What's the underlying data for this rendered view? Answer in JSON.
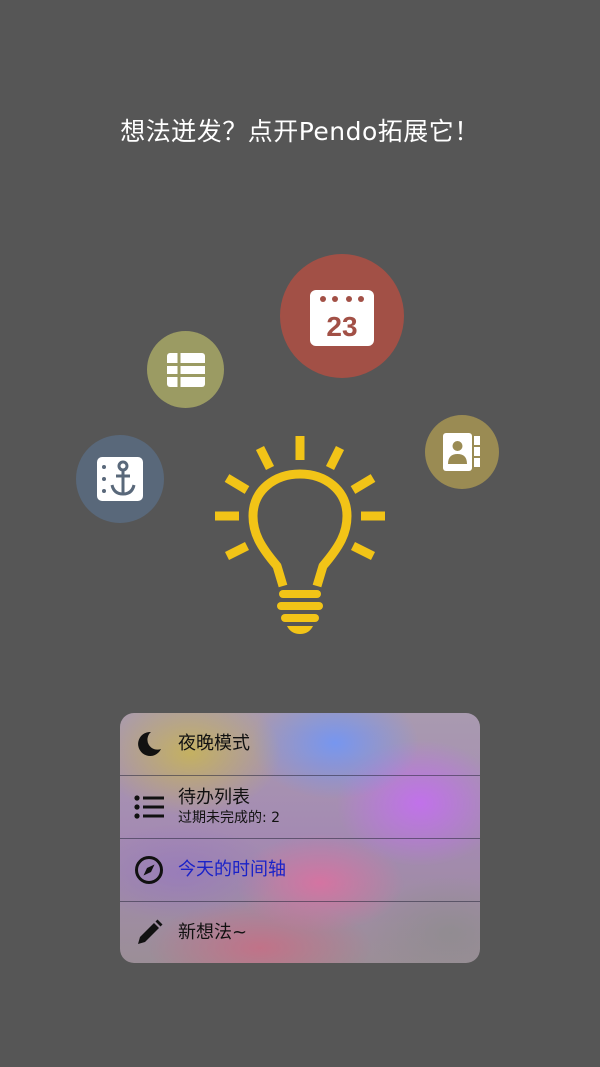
{
  "headline": "想法迸发？点开Pendo拓展它！",
  "bubbles": {
    "calendar": {
      "icon": "calendar-icon",
      "day": "23",
      "color": "#a25046"
    },
    "table": {
      "icon": "table-icon",
      "color": "#9b9b63"
    },
    "notebook": {
      "icon": "anchor-notebook-icon",
      "color": "#59687a"
    },
    "contacts": {
      "icon": "contacts-book-icon",
      "color": "#9a8b53"
    }
  },
  "bulb": {
    "icon": "lightbulb-icon",
    "color": "#f2c417"
  },
  "quick_actions": {
    "items": [
      {
        "icon": "moon-icon",
        "title": "夜晚模式"
      },
      {
        "icon": "list-icon",
        "title": "待办列表",
        "subtitle": "过期未完成的: 2"
      },
      {
        "icon": "compass-icon",
        "title": "今天的时间轴",
        "title_color": "#1a22c8"
      },
      {
        "icon": "pencil-icon",
        "title": "新想法~"
      }
    ]
  }
}
